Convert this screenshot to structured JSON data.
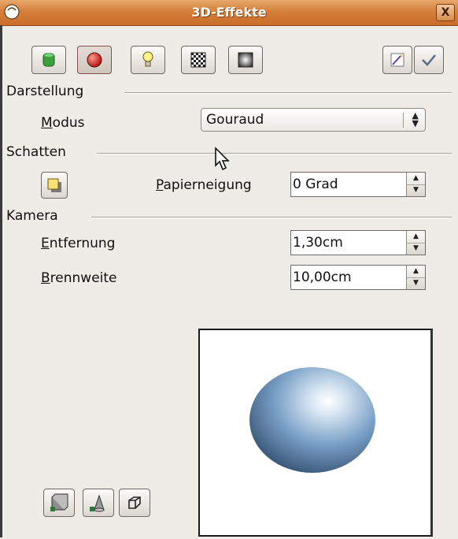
{
  "window": {
    "title": "3D-Effekte",
    "close_glyph": "X"
  },
  "toolbar": {
    "icons": [
      "geometry-icon",
      "shading-icon",
      "light-bulb-icon",
      "texture-icon",
      "material-icon"
    ],
    "active_index": 1,
    "right_icons": [
      "assign-icon",
      "apply-checkmark-icon"
    ]
  },
  "darstellung": {
    "heading": "Darstellung",
    "modus_label_ul": "M",
    "modus_label_rest": "odus",
    "modus_value": "Gouraud"
  },
  "schatten": {
    "heading": "Schatten",
    "papierneigung_ul": "P",
    "papierneigung_rest": "apierneigung",
    "papierneigung_value": "0 Grad"
  },
  "kamera": {
    "heading": "Kamera",
    "entfernung_ul": "E",
    "entfernung_rest": "ntfernung",
    "entfernung_value": "1,30cm",
    "brennweite_ul": "B",
    "brennweite_rest": "rennweite",
    "brennweite_value": "10,00cm"
  },
  "bottom_buttons": [
    "convert-to-3d-icon",
    "convert-to-lathe-icon",
    "perspective-icon"
  ],
  "colors": {
    "titlebar": "#d57f3a",
    "background": "#efebe7",
    "sphere": "#6f96bd"
  }
}
